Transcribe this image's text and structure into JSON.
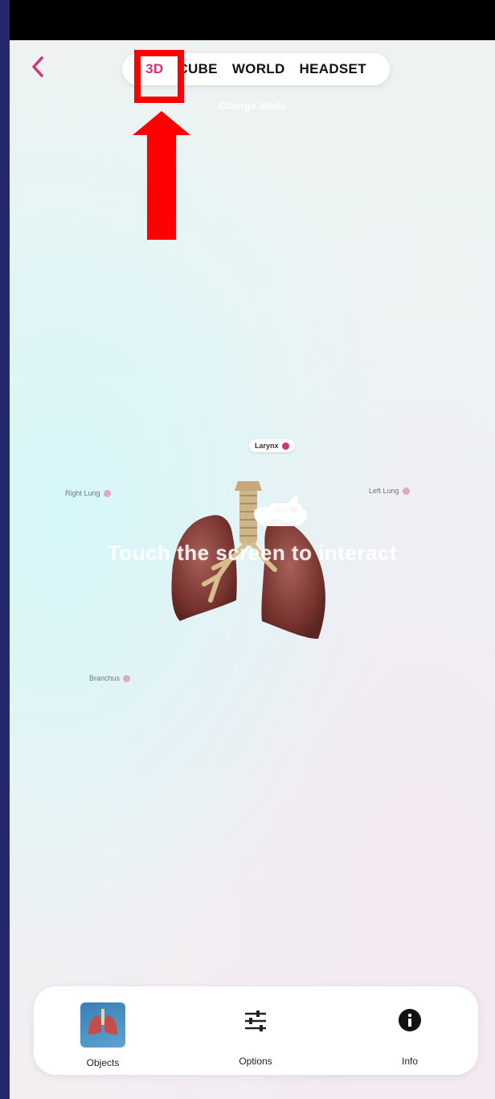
{
  "status_bar": {},
  "header": {
    "modes": [
      "3D",
      "CUBE",
      "WORLD",
      "HEADSET"
    ],
    "active_mode": "3D",
    "subtitle": "Change Mode"
  },
  "scene": {
    "hint": "Touch the screen to interact",
    "labels": {
      "larynx": "Larynx",
      "trachea": "nea",
      "right_lung": "Right Lung",
      "left_lung": "Left Lung",
      "bronchus": "Branchus"
    }
  },
  "bottom_nav": {
    "objects": "Objects",
    "options": "Options",
    "info": "Info"
  },
  "colors": {
    "accent": "#d8317b",
    "annotation": "#ff0000"
  }
}
